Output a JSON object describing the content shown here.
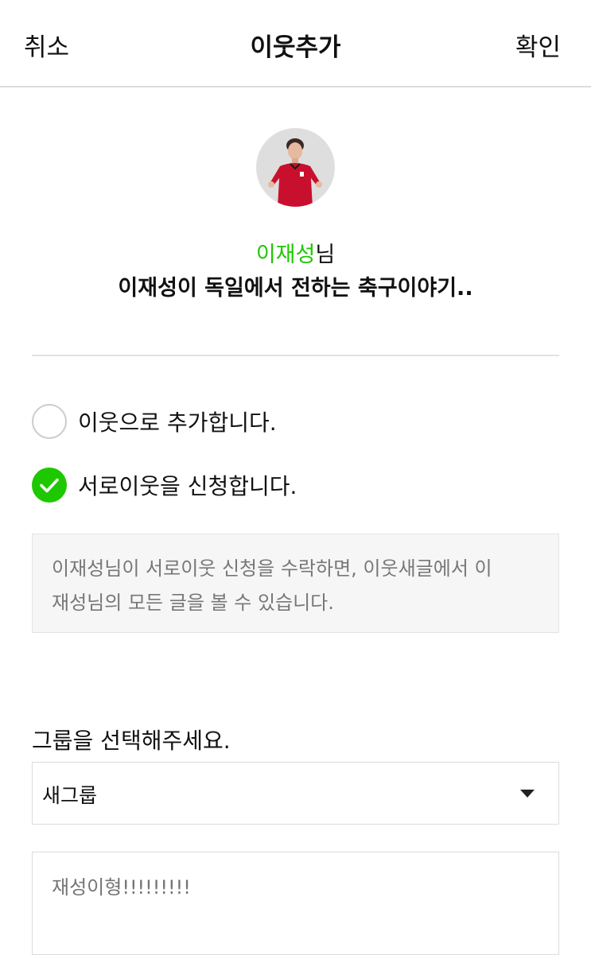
{
  "header": {
    "cancel_label": "취소",
    "title": "이웃추가",
    "confirm_label": "확인"
  },
  "profile": {
    "name": "이재성",
    "name_suffix": "님",
    "blog_title": "이재성이 독일에서 전하는 축구이야기..",
    "name_color": "#1ec800"
  },
  "options": [
    {
      "label": "이웃으로 추가합니다.",
      "checked": false
    },
    {
      "label": "서로이웃을 신청합니다.",
      "checked": true
    }
  ],
  "notice": {
    "line1": "이재성님이 서로이웃 신청을 수락하면, 이웃새글에서 이",
    "line2": "재성님의 모든 글을 볼 수 있습니다."
  },
  "group": {
    "label": "그룹을 선택해주세요.",
    "selected": "새그룹"
  },
  "message": {
    "placeholder": "재성이형!!!!!!!!!"
  },
  "colors": {
    "accent": "#1ec800",
    "divider": "#dcdcdc",
    "notice_bg": "#f6f6f6"
  }
}
